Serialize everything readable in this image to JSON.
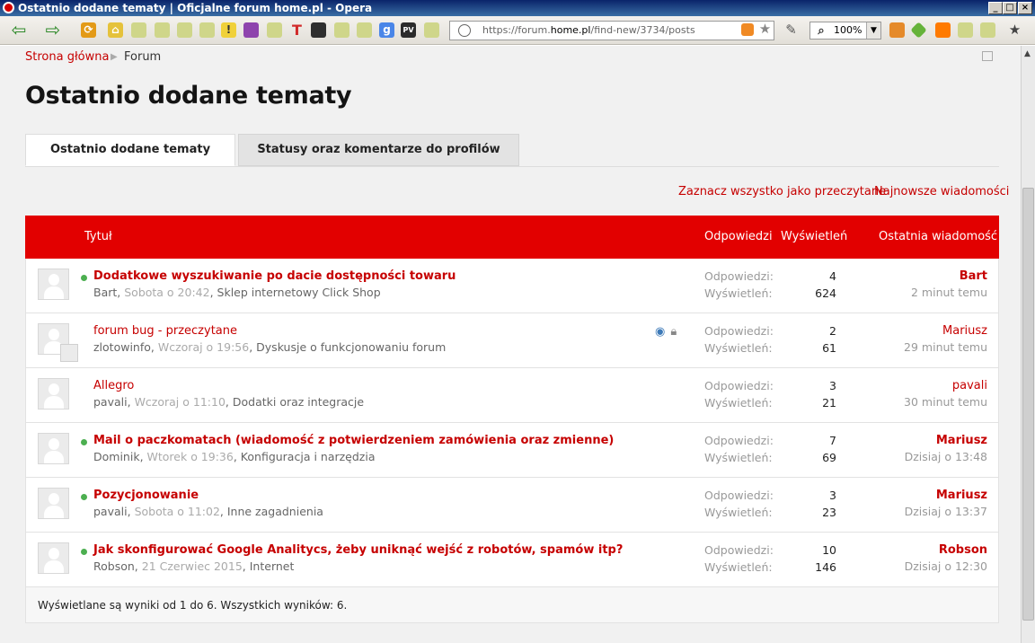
{
  "window": {
    "title": "Ostatnio dodane tematy | Oficjalne forum home.pl - Opera"
  },
  "browser": {
    "url_prefix": "https://forum.",
    "url_domain": "home.pl",
    "url_path": "/find-new/3734/posts",
    "zoom": "100%"
  },
  "breadcrumb": {
    "home": "Strona główna",
    "current": "Forum"
  },
  "page": {
    "title": "Ostatnio dodane tematy",
    "tabs": [
      {
        "label": "Ostatnio dodane tematy",
        "active": true
      },
      {
        "label": "Statusy oraz komentarze do profilów",
        "active": false
      }
    ],
    "links": {
      "mark_all_read": "Zaznacz wszystko jako przeczytane",
      "newest_messages": "Najnowsze wiadomości"
    }
  },
  "table": {
    "headers": {
      "title": "Tytuł",
      "replies": "Odpowiedzi",
      "views": "Wyświetleń",
      "last": "Ostatnia wiadomość"
    },
    "row_labels": {
      "replies": "Odpowiedzi:",
      "views": "Wyświetleń:"
    },
    "rows": [
      {
        "title": "Dodatkowe wyszukiwanie po dacie dostępności towaru",
        "unread": true,
        "author": "Bart",
        "date": "Sobota o 20:42",
        "forum": "Sklep internetowy Click Shop",
        "replies": "4",
        "views": "624",
        "last_user": "Bart",
        "last_time": "2 minut temu"
      },
      {
        "title": "forum bug - przeczytane",
        "unread": false,
        "author": "zlotowinfo",
        "date": "Wczoraj o 19:56",
        "forum": "Dyskusje o funkcjonowaniu forum",
        "replies": "2",
        "views": "61",
        "last_user": "Mariusz",
        "last_time": "29 minut temu"
      },
      {
        "title": "Allegro",
        "unread": false,
        "author": "pavali",
        "date": "Wczoraj o 11:10",
        "forum": "Dodatki oraz integracje",
        "replies": "3",
        "views": "21",
        "last_user": "pavali",
        "last_time": "30 minut temu"
      },
      {
        "title": "Mail o paczkomatach (wiadomość z potwierdzeniem zamówienia oraz zmienne)",
        "unread": true,
        "author": "Dominik",
        "date": "Wtorek o 19:36",
        "forum": "Konfiguracja i narzędzia",
        "replies": "7",
        "views": "69",
        "last_user": "Mariusz",
        "last_time": "Dzisiaj o 13:48"
      },
      {
        "title": "Pozycjonowanie",
        "unread": true,
        "author": "pavali",
        "date": "Sobota o 11:02",
        "forum": "Inne zagadnienia",
        "replies": "3",
        "views": "23",
        "last_user": "Mariusz",
        "last_time": "Dzisiaj o 13:37"
      },
      {
        "title": "Jak skonfigurować Google Analitycs, żeby uniknąć wejść z robotów, spamów itp?",
        "unread": true,
        "author": "Robson",
        "date": "21 Czerwiec 2015",
        "forum": "Internet",
        "replies": "10",
        "views": "146",
        "last_user": "Robson",
        "last_time": "Dzisiaj o 12:30"
      }
    ],
    "footer": "Wyświetlane są wyniki od 1 do 6. Wszystkich wyników: 6."
  },
  "colors": {
    "accent": "#e20000",
    "link": "#c60000",
    "unread_dot": "#4caf50"
  }
}
